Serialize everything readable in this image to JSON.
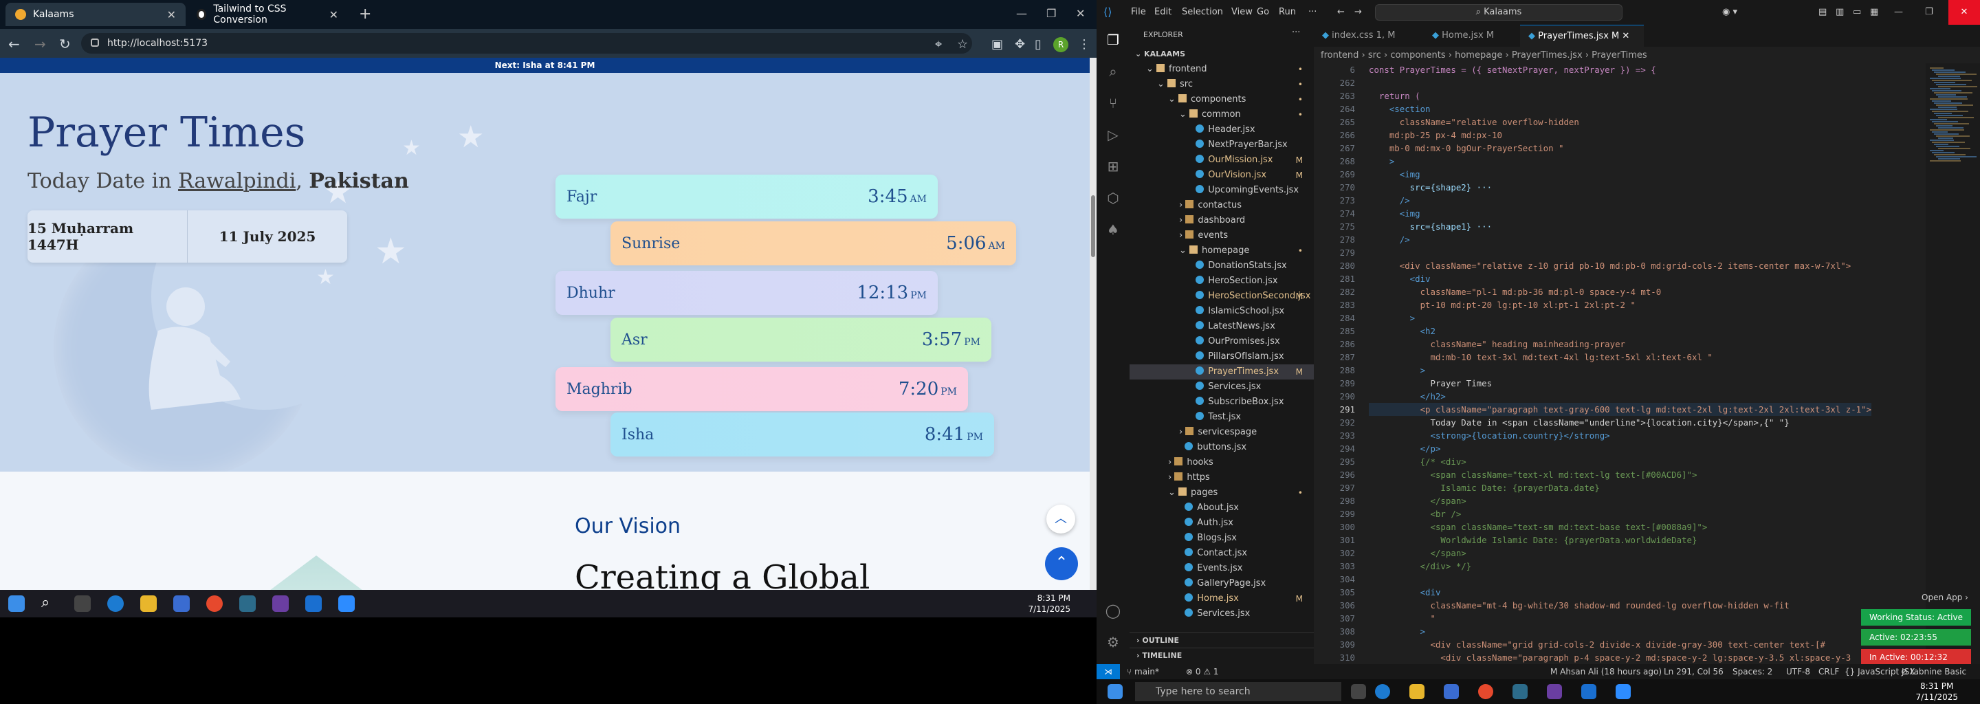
{
  "browser": {
    "tabs": [
      {
        "title": "Kalaams",
        "active": true
      },
      {
        "title": "Tailwind to CSS Conversion",
        "active": false
      }
    ],
    "url": "http://localhost:5173",
    "profile_initial": "R"
  },
  "site": {
    "next_prayer_banner": "Next: Isha at 8:41 PM",
    "title": "Prayer Times",
    "subtitle_prefix": "Today Date in ",
    "city": "Rawalpindi",
    "separator": ", ",
    "country": "Pakistan",
    "hijri_date": "15 Muḥarram 1447H",
    "gregorian_date": "11 July 2025",
    "prayers": [
      {
        "name": "Fajr",
        "time": "3:45",
        "ampm": "AM",
        "color": "#b7f3f1"
      },
      {
        "name": "Sunrise",
        "time": "5:06",
        "ampm": "AM",
        "color": "#fcd3a6"
      },
      {
        "name": "Dhuhr",
        "time": "12:13",
        "ampm": "PM",
        "color": "#d4d8f7"
      },
      {
        "name": "Asr",
        "time": "3:57",
        "ampm": "PM",
        "color": "#c7f3c4"
      },
      {
        "name": "Maghrib",
        "time": "7:20",
        "ampm": "PM",
        "color": "#fbcde0"
      },
      {
        "name": "Isha",
        "time": "8:41",
        "ampm": "PM",
        "color": "#a6e3f7"
      }
    ],
    "vision_title": "Our Vision",
    "vision_heading": "Creating a Global",
    "scroll_top_icon": "chevron-up-icon",
    "scroll_up_icon": "arrow-up-icon"
  },
  "left_taskbar": {
    "time": "8:31 PM",
    "date": "7/11/2025"
  },
  "vscode": {
    "menu": [
      "File",
      "Edit",
      "Selection",
      "View",
      "Go",
      "Run",
      "···"
    ],
    "search": "Kalaams",
    "explorer_title": "EXPLORER",
    "tree": [
      {
        "label": "KALAAMS",
        "depth": 0,
        "type": "root"
      },
      {
        "label": "frontend",
        "depth": 1,
        "type": "folder",
        "status": "•"
      },
      {
        "label": "src",
        "depth": 2,
        "type": "folder",
        "status": "•"
      },
      {
        "label": "components",
        "depth": 3,
        "type": "folder",
        "status": "•"
      },
      {
        "label": "common",
        "depth": 4,
        "type": "folder",
        "status": "•"
      },
      {
        "label": "Header.jsx",
        "depth": 5,
        "type": "file"
      },
      {
        "label": "NextPrayerBar.jsx",
        "depth": 5,
        "type": "file"
      },
      {
        "label": "OurMission.jsx",
        "depth": 5,
        "type": "file",
        "status": "M"
      },
      {
        "label": "OurVision.jsx",
        "depth": 5,
        "type": "file",
        "status": "M"
      },
      {
        "label": "UpcomingEvents.jsx",
        "depth": 5,
        "type": "file"
      },
      {
        "label": "contactus",
        "depth": 4,
        "type": "folder-closed"
      },
      {
        "label": "dashboard",
        "depth": 4,
        "type": "folder-closed"
      },
      {
        "label": "events",
        "depth": 4,
        "type": "folder-closed"
      },
      {
        "label": "homepage",
        "depth": 4,
        "type": "folder",
        "status": "•"
      },
      {
        "label": "DonationStats.jsx",
        "depth": 5,
        "type": "file"
      },
      {
        "label": "HeroSection.jsx",
        "depth": 5,
        "type": "file"
      },
      {
        "label": "HeroSectionSecond.jsx",
        "depth": 5,
        "type": "file",
        "status": "M"
      },
      {
        "label": "IslamicSchool.jsx",
        "depth": 5,
        "type": "file"
      },
      {
        "label": "LatestNews.jsx",
        "depth": 5,
        "type": "file"
      },
      {
        "label": "OurPromises.jsx",
        "depth": 5,
        "type": "file"
      },
      {
        "label": "PillarsOfIslam.jsx",
        "depth": 5,
        "type": "file"
      },
      {
        "label": "PrayerTimes.jsx",
        "depth": 5,
        "type": "file",
        "status": "M",
        "selected": true
      },
      {
        "label": "Services.jsx",
        "depth": 5,
        "type": "file"
      },
      {
        "label": "SubscribeBox.jsx",
        "depth": 5,
        "type": "file"
      },
      {
        "label": "Test.jsx",
        "depth": 5,
        "type": "file"
      },
      {
        "label": "servicespage",
        "depth": 4,
        "type": "folder-closed"
      },
      {
        "label": "buttons.jsx",
        "depth": 4,
        "type": "file"
      },
      {
        "label": "hooks",
        "depth": 3,
        "type": "folder-closed"
      },
      {
        "label": "https",
        "depth": 3,
        "type": "folder-closed"
      },
      {
        "label": "pages",
        "depth": 3,
        "type": "folder",
        "status": "•"
      },
      {
        "label": "About.jsx",
        "depth": 4,
        "type": "file"
      },
      {
        "label": "Auth.jsx",
        "depth": 4,
        "type": "file"
      },
      {
        "label": "Blogs.jsx",
        "depth": 4,
        "type": "file"
      },
      {
        "label": "Contact.jsx",
        "depth": 4,
        "type": "file"
      },
      {
        "label": "Events.jsx",
        "depth": 4,
        "type": "file"
      },
      {
        "label": "GalleryPage.jsx",
        "depth": 4,
        "type": "file"
      },
      {
        "label": "Home.jsx",
        "depth": 4,
        "type": "file",
        "status": "M"
      },
      {
        "label": "Services.jsx",
        "depth": 4,
        "type": "file"
      }
    ],
    "outline": "OUTLINE",
    "timeline": "TIMELINE",
    "editor_tabs": [
      {
        "label": "index.css 1, M",
        "active": false
      },
      {
        "label": "Home.jsx M",
        "active": false
      },
      {
        "label": "PrayerTimes.jsx M",
        "active": true
      }
    ],
    "breadcrumb": "frontend › src › components › homepage › PrayerTimes.jsx › PrayerTimes",
    "code_lines": [
      {
        "n": "6",
        "t": "const PrayerTimes = ({ setNextPrayer, nextPrayer }) => {",
        "c": "kw"
      },
      {
        "n": "262",
        "t": "",
        "c": ""
      },
      {
        "n": "263",
        "t": "  return (",
        "c": "kw"
      },
      {
        "n": "264",
        "t": "    <section",
        "c": "tg"
      },
      {
        "n": "265",
        "t": "      className=\"relative overflow-hidden",
        "c": "st"
      },
      {
        "n": "266",
        "t": "    md:pb-25 px-4 md:px-10",
        "c": "st"
      },
      {
        "n": "267",
        "t": "    mb-0 md:mx-0 bgOur-PrayerSection \"",
        "c": "st"
      },
      {
        "n": "268",
        "t": "    >",
        "c": "tg"
      },
      {
        "n": "269",
        "t": "      <img",
        "c": "tg"
      },
      {
        "n": "270",
        "t": "        src={shape2} ···",
        "c": "at"
      },
      {
        "n": "273",
        "t": "      />",
        "c": "tg"
      },
      {
        "n": "274",
        "t": "      <img",
        "c": "tg"
      },
      {
        "n": "275",
        "t": "        src={shape1} ···",
        "c": "at"
      },
      {
        "n": "278",
        "t": "      />",
        "c": "tg"
      },
      {
        "n": "279",
        "t": "",
        "c": ""
      },
      {
        "n": "280",
        "t": "      <div className=\"relative z-10 grid pb-10 md:pb-0 md:grid-cols-2 items-center max-w-7xl\">",
        "c": "st"
      },
      {
        "n": "281",
        "t": "        <div",
        "c": "tg"
      },
      {
        "n": "282",
        "t": "          className=\"pl-1 md:pb-36 md:pl-0 space-y-4 mt-0",
        "c": "st"
      },
      {
        "n": "283",
        "t": "          pt-10 md:pt-20 lg:pt-10 xl:pt-1 2xl:pt-2 \"",
        "c": "st"
      },
      {
        "n": "284",
        "t": "        >",
        "c": "tg"
      },
      {
        "n": "285",
        "t": "          <h2",
        "c": "tg"
      },
      {
        "n": "286",
        "t": "            className=\" heading mainheading-prayer",
        "c": "st"
      },
      {
        "n": "287",
        "t": "            md:mb-10 text-3xl md:text-4xl lg:text-5xl xl:text-6xl \"",
        "c": "st"
      },
      {
        "n": "288",
        "t": "          >",
        "c": "tg"
      },
      {
        "n": "289",
        "t": "            Prayer Times",
        "c": ""
      },
      {
        "n": "290",
        "t": "          </h2>",
        "c": "tg"
      },
      {
        "n": "291",
        "t": "          <p className=\"paragraph text-gray-600 text-lg md:text-2xl lg:text-2xl 2xl:text-3xl z-1\">",
        "c": "st"
      },
      {
        "n": "292",
        "t": "            Today Date in <span className=\"underline\">{location.city}</span>,{\" \"}",
        "c": ""
      },
      {
        "n": "293",
        "t": "            <strong>{location.country}</strong>",
        "c": "tg"
      },
      {
        "n": "294",
        "t": "          </p>",
        "c": "tg"
      },
      {
        "n": "295",
        "t": "          {/* <div>",
        "c": "cm"
      },
      {
        "n": "296",
        "t": "            <span className=\"text-xl md:text-lg text-[#00ACD6]\">",
        "c": "cm"
      },
      {
        "n": "297",
        "t": "              Islamic Date: {prayerData.date}",
        "c": "cm"
      },
      {
        "n": "298",
        "t": "            </span>",
        "c": "cm"
      },
      {
        "n": "299",
        "t": "            <br />",
        "c": "cm"
      },
      {
        "n": "300",
        "t": "            <span className=\"text-sm md:text-base text-[#0088a9]\">",
        "c": "cm"
      },
      {
        "n": "301",
        "t": "              Worldwide Islamic Date: {prayerData.worldwideDate}",
        "c": "cm"
      },
      {
        "n": "302",
        "t": "            </span>",
        "c": "cm"
      },
      {
        "n": "303",
        "t": "          </div> */}",
        "c": "cm"
      },
      {
        "n": "304",
        "t": "",
        "c": ""
      },
      {
        "n": "305",
        "t": "          <div",
        "c": "tg"
      },
      {
        "n": "306",
        "t": "            className=\"mt-4 bg-white/30 shadow-md rounded-lg overflow-hidden w-fit",
        "c": "st"
      },
      {
        "n": "307",
        "t": "            \"",
        "c": "st"
      },
      {
        "n": "308",
        "t": "          >",
        "c": "tg"
      },
      {
        "n": "309",
        "t": "            <div className=\"grid grid-cols-2 divide-x divide-gray-300 text-center text-[#",
        "c": "st"
      },
      {
        "n": "310",
        "t": "              <div className=\"paragraph p-4 space-y-2 md:space-y-2 lg:space-y-3.5 xl:space-y-3",
        "c": "st"
      }
    ],
    "open_app": "Open App ›",
    "working_status": "Working Status: Active",
    "active_time": "Active: 02:23:55",
    "inactive_time": "In Active: 00:12:32",
    "status": {
      "branch": "main*",
      "errors": "⊗ 0 ⚠ 1",
      "blame": "M Ahsan Ali (18 hours ago)",
      "position": "Ln 291, Col 56",
      "spaces": "Spaces: 2",
      "encoding": "UTF-8",
      "eol": "CRLF",
      "language": "{} JavaScript JSX",
      "extra": "⊘ tabnine Basic",
      "prettier": "✓ Prettier"
    }
  },
  "right_taskbar": {
    "search_placeholder": "Type here to search",
    "time": "8:31 PM",
    "date": "7/11/2025"
  }
}
